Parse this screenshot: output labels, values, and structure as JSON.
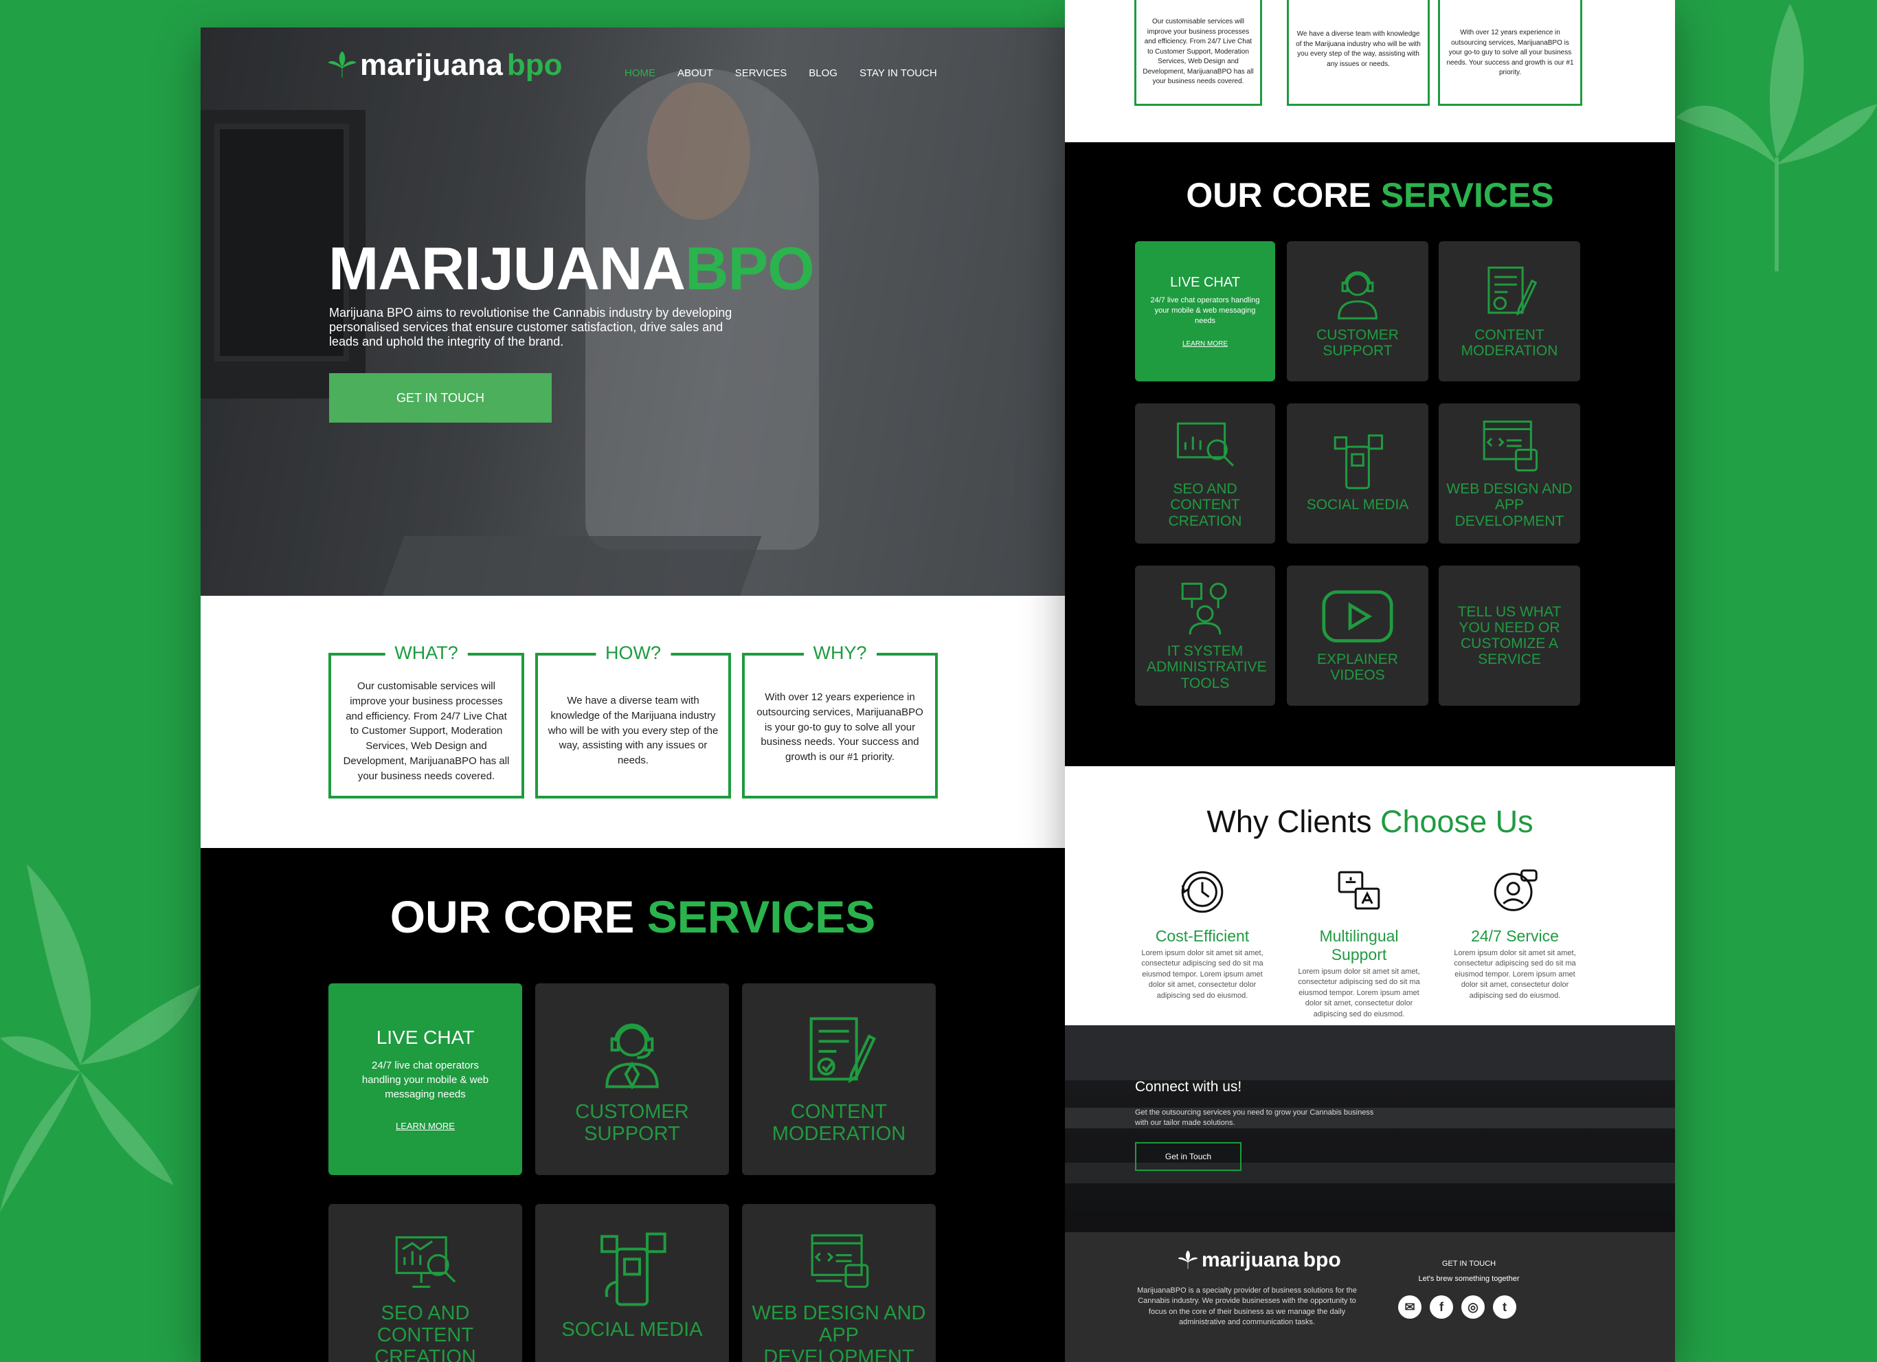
{
  "brand": {
    "name_part1": "marijuana",
    "name_part2": "bpo",
    "accent": "#2bb34d",
    "background": "#22a046"
  },
  "nav": {
    "items": [
      "HOME",
      "ABOUT",
      "SERVICES",
      "BLOG",
      "STAY IN TOUCH"
    ],
    "active": "HOME"
  },
  "hero": {
    "title_part1": "MARIJUANA",
    "title_part2": "BPO",
    "description": "Marijuana BPO aims to revolutionise the Cannabis industry by developing personalised services that ensure customer satisfaction, drive sales and leads and uphold the integrity of the brand.",
    "cta": "GET IN TOUCH"
  },
  "info_boxes": [
    {
      "title": "WHAT?",
      "text": "Our customisable services will improve your business processes and efficiency. From 24/7 Live Chat to Customer Support, Moderation Services, Web Design and Development, MarijuanaBPO has all your business needs covered."
    },
    {
      "title": "HOW?",
      "text": "We have a diverse team with knowledge of the Marijuana industry who will be with you every step of the way, assisting with any issues or needs."
    },
    {
      "title": "WHY?",
      "text": "With over 12 years experience in outsourcing services, MarijuanaBPO is your go-to guy to solve all your business needs. Your success and growth is our #1 priority."
    }
  ],
  "services": {
    "title_part1": "OUR CORE",
    "title_part2": "SERVICES",
    "cards": [
      {
        "label": "LIVE CHAT",
        "sub": "24/7 live chat operators handling your mobile & web messaging needs",
        "link": "LEARN MORE",
        "icon": "chat-icon"
      },
      {
        "label": "CUSTOMER SUPPORT",
        "icon": "headset-agent-icon"
      },
      {
        "label": "CONTENT MODERATION",
        "icon": "document-pen-icon"
      },
      {
        "label": "SEO AND CONTENT CREATION",
        "icon": "analytics-magnifier-icon"
      },
      {
        "label": "SOCIAL MEDIA",
        "icon": "phone-social-icon"
      },
      {
        "label": "WEB DESIGN AND APP DEVELOPMENT",
        "icon": "web-code-icon"
      },
      {
        "label": "IT SYSTEM ADMINISTRATIVE TOOLS",
        "icon": "it-admin-icon"
      },
      {
        "label": "EXPLAINER VIDEOS",
        "icon": "play-icon"
      },
      {
        "label": "TELL US WHAT YOU NEED OR CUSTOMIZE A SERVICE",
        "icon": ""
      }
    ]
  },
  "why": {
    "title_part1": "Why Clients",
    "title_part2": "Choose Us",
    "items": [
      {
        "title": "Cost-Efficient",
        "text": "Lorem ipsum dolor sit amet sit amet, consectetur adipiscing sed do sit ma eiusmod tempor. Lorem ipsum amet dolor sit amet, consectetur dolor adipiscing sed do eiusmod.",
        "icon": "clock-cycle-icon"
      },
      {
        "title": "Multilingual Support",
        "text": "Lorem ipsum dolor sit amet sit amet, consectetur adipiscing sed do sit ma eiusmod tempor. Lorem ipsum amet dolor sit amet, consectetur dolor adipiscing sed do eiusmod.",
        "icon": "translate-icon"
      },
      {
        "title": "24/7 Service",
        "text": "Lorem ipsum dolor sit amet sit amet, consectetur adipiscing sed do sit ma eiusmod tempor. Lorem ipsum amet dolor sit amet, consectetur dolor adipiscing sed do eiusmod.",
        "icon": "support-24-icon"
      }
    ]
  },
  "connect": {
    "title": "Connect with us!",
    "text": "Get the outsourcing services you need to grow your Cannabis business with our tailor made solutions.",
    "button": "Get in Touch"
  },
  "footer": {
    "about": "MarijuanaBPO is a specialty provider of business solutions for the Cannabis industry. We provide businesses with the opportunity to focus on the core of their business as we manage the daily administrative and communication tasks.",
    "get_in_touch": "GET IN TOUCH",
    "tagline": "Let's brew something together",
    "social": [
      "email-icon",
      "facebook-icon",
      "instagram-icon",
      "twitter-icon"
    ]
  }
}
